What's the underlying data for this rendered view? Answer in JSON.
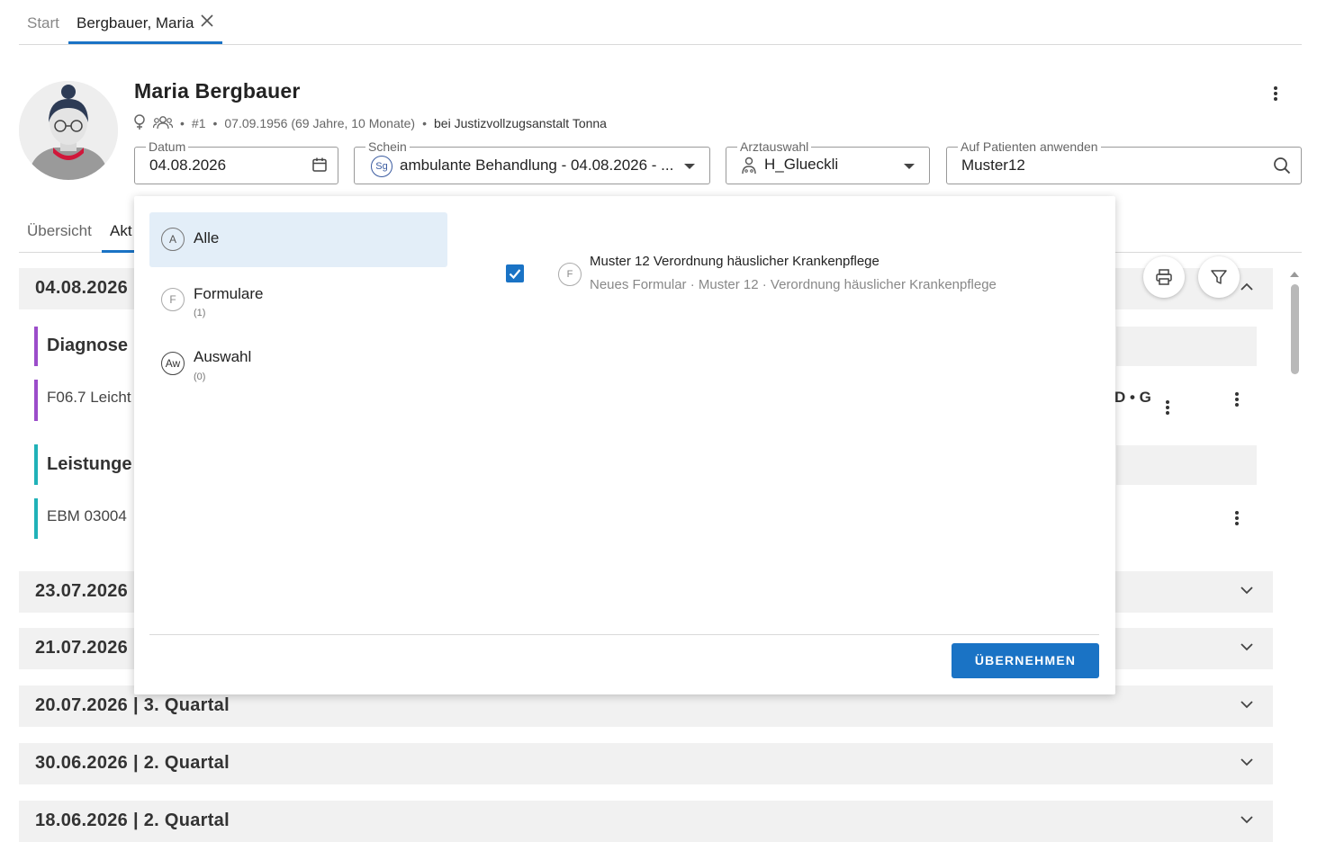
{
  "top_tabs": {
    "start": "Start",
    "patient": "Bergbauer, Maria"
  },
  "patient": {
    "name": "Maria Bergbauer",
    "number": "#1",
    "birth": "07.09.1956 (69 Jahre, 10 Monate)",
    "location": "bei Justizvollzugsanstalt Tonna"
  },
  "fields": {
    "datum_label": "Datum",
    "datum_value": "04.08.2026",
    "schein_label": "Schein",
    "schein_badge": "Sg",
    "schein_value": "ambulante Behandlung - 04.08.2026 - ...",
    "arzt_label": "Arztauswahl",
    "arzt_value": "H_Glueckli",
    "search_label": "Auf Patienten anwenden",
    "search_value": "Muster12"
  },
  "secondary_tabs": {
    "overview": "Übersicht",
    "active": "Akt"
  },
  "background": {
    "day1": "04.08.2026",
    "diagnose_title": "Diagnose",
    "diagnose_entry": "F06.7 Leicht",
    "diagnose_suffix": "D • G",
    "leistung_title": "Leistunge",
    "leistung_entry": "EBM 03004",
    "day2": "23.07.2026",
    "day3": "21.07.2026 |",
    "day4": "20.07.2026 | 3. Quartal",
    "day5": "30.06.2026 | 2. Quartal",
    "day6": "18.06.2026 | 2. Quartal"
  },
  "popup": {
    "categories": [
      {
        "icon": "A",
        "label": "Alle",
        "count": ""
      },
      {
        "icon": "F",
        "label": "Formulare",
        "count": "(1)"
      },
      {
        "icon": "Aw",
        "label": "Auswahl",
        "count": "(0)"
      }
    ],
    "item": {
      "icon": "F",
      "title": "Muster 12 Verordnung häuslicher Krankenpflege",
      "subtitle": "Neues Formular · Muster 12 · Verordnung häuslicher Krankenpflege",
      "checked": true
    },
    "apply_label": "ÜBERNEHMEN"
  },
  "colors": {
    "accent": "#1a73c5",
    "diagnose_bar": "#9b4dca",
    "leistung_bar": "#20b2b8",
    "selected_bg": "#e3eef8"
  }
}
